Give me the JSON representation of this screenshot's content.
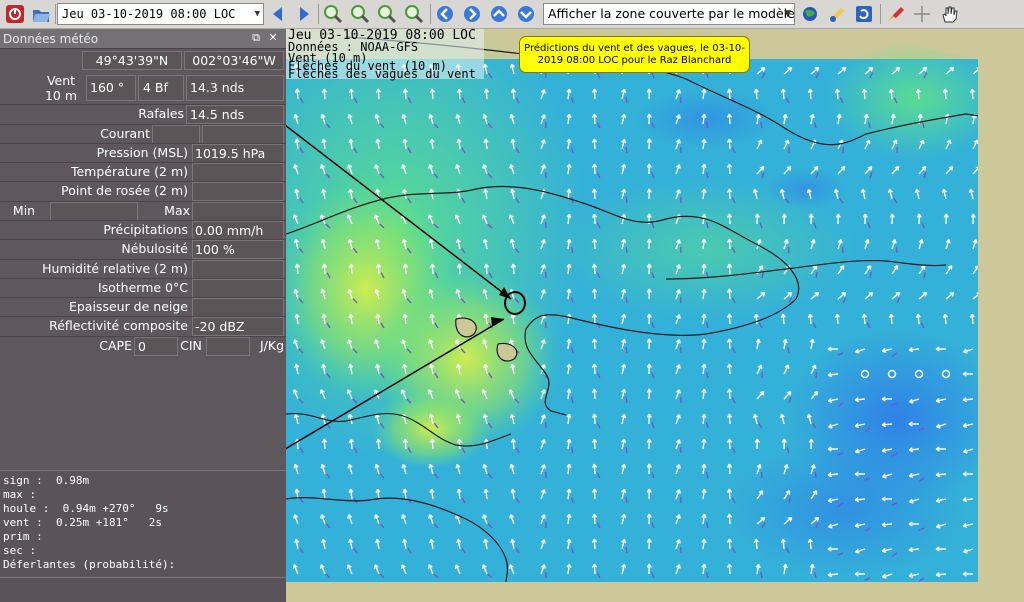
{
  "toolbar": {
    "datetime": "Jeu 03-10-2019 08:00 LOC",
    "coverage_option": "Afficher la zone couverte par le modèle",
    "icons": [
      "close-icon",
      "folder-open-icon",
      "previous-icon",
      "next-icon",
      "zoom-in-icon",
      "zoom-out-icon",
      "zoom-fit-icon",
      "zoom-reset-icon",
      "back-icon",
      "forward-icon",
      "up-icon",
      "down-icon",
      "globe-icon",
      "color-icon",
      "refresh-icon",
      "rocket-icon",
      "crosshair-icon",
      "hand-icon"
    ]
  },
  "panel": {
    "title": "Données météo",
    "lat": "49°43'39\"N",
    "lon": "002°03'46\"W",
    "wind_label_1": "Vent",
    "wind_label_2": "10 m",
    "wind_dir": "160 °",
    "wind_bf": "4 Bf",
    "wind_speed": "14.3 nds",
    "gust_label": "Rafales",
    "gust_value": "14.5 nds",
    "current_label": "Courant",
    "pressure_label": "Pression (MSL)",
    "pressure_value": "1019.5 hPa",
    "temp_label": "Température (2 m)",
    "dew_label": "Point de rosée (2 m)",
    "min_label": "Min",
    "max_label": "Max",
    "precip_label": "Précipitations",
    "precip_value": "0.00 mm/h",
    "cloud_label": "Nébulosité",
    "cloud_value": "100 %",
    "humidity_label": "Humidité relative (2 m)",
    "iso_label": "Isotherme 0°C",
    "snow_label": "Epaisseur de neige",
    "refl_label": "Réflectivité composite",
    "refl_value": "-20 dBZ",
    "cape_label": "CAPE",
    "cape_value": "0",
    "cin_label": "CIN",
    "cin_unit": "J/Kg",
    "waves": {
      "sign": "sign :  0.98m",
      "max": "max :",
      "houle": "houle :  0.94m +270°   9s",
      "vent": "vent :  0.25m +181°   2s",
      "prim": "prim :",
      "sec": "sec :",
      "deferlantes": "Déferlantes (probabilité):"
    }
  },
  "map": {
    "header_date": "Jeu 03-10-2019 08:00 LOC",
    "header_source": "Données : NOAA-GFS",
    "header_layer": "Vent (10 m)",
    "header_arrows_wind": "Flèches du vent (10 m)",
    "header_arrows_waves": "Flèches des vagues du vent",
    "callout": "Prédictions du vent et des vagues, le 03-10-2019 08:00 LOC pour le Raz Blanchard",
    "colors": {
      "sea": "#2aa6e0",
      "calm": "#2f7fe8",
      "wind_green": "#5ee08a",
      "wind_yellow": "#d6ef4c",
      "land": "#cdc89a",
      "coast": "#1a1a1a",
      "callout": "#ffff00"
    }
  }
}
